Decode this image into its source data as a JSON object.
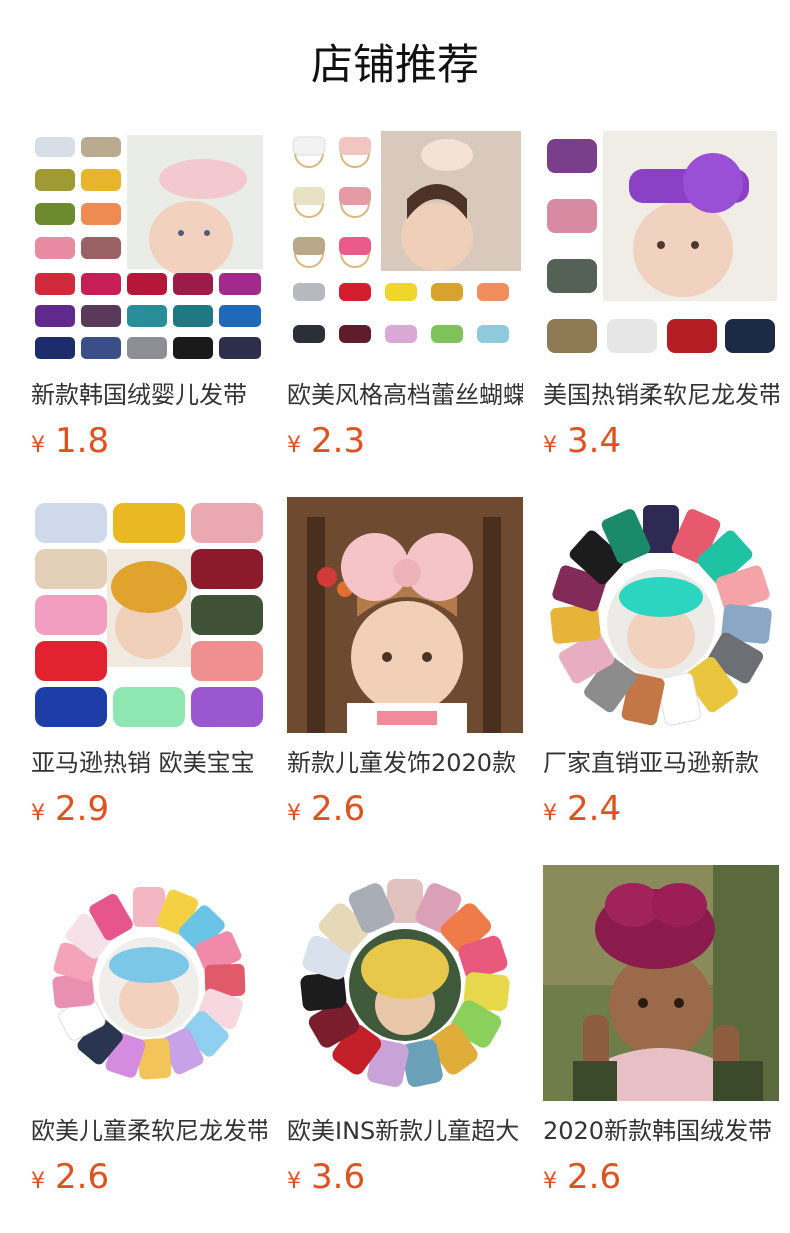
{
  "header": {
    "title": "店铺推荐"
  },
  "products": [
    {
      "name": "新款韩国绒婴儿发带",
      "currency": "¥",
      "price": "1.8",
      "image_icon": "velvet-bow-headbands-grid-photo"
    },
    {
      "name": "欧美风格高档蕾丝蝴蝶",
      "currency": "¥",
      "price": "2.3",
      "image_icon": "lace-bow-headbands-photo"
    },
    {
      "name": "美国热销柔软尼龙发带",
      "currency": "¥",
      "price": "3.4",
      "image_icon": "flower-nylon-headbands-photo"
    },
    {
      "name": "亚马逊热销 欧美宝宝",
      "currency": "¥",
      "price": "2.9",
      "image_icon": "flower-turban-headbands-photo"
    },
    {
      "name": "新款儿童发饰2020款",
      "currency": "¥",
      "price": "2.6",
      "image_icon": "pink-bow-baby-photo"
    },
    {
      "name": "厂家直销亚马逊新款",
      "currency": "¥",
      "price": "2.4",
      "image_icon": "bow-headbands-circle-photo"
    },
    {
      "name": "欧美儿童柔软尼龙发带",
      "currency": "¥",
      "price": "2.6",
      "image_icon": "printed-bow-headbands-circle-photo"
    },
    {
      "name": "欧美INS新款儿童超大",
      "currency": "¥",
      "price": "3.6",
      "image_icon": "turban-headbands-circle-photo"
    },
    {
      "name": "2020新款韩国绒发带",
      "currency": "¥",
      "price": "2.6",
      "image_icon": "velvet-turban-baby-photo"
    }
  ],
  "colors": {
    "price": "#e2501d",
    "text": "#333333",
    "title": "#111111"
  }
}
